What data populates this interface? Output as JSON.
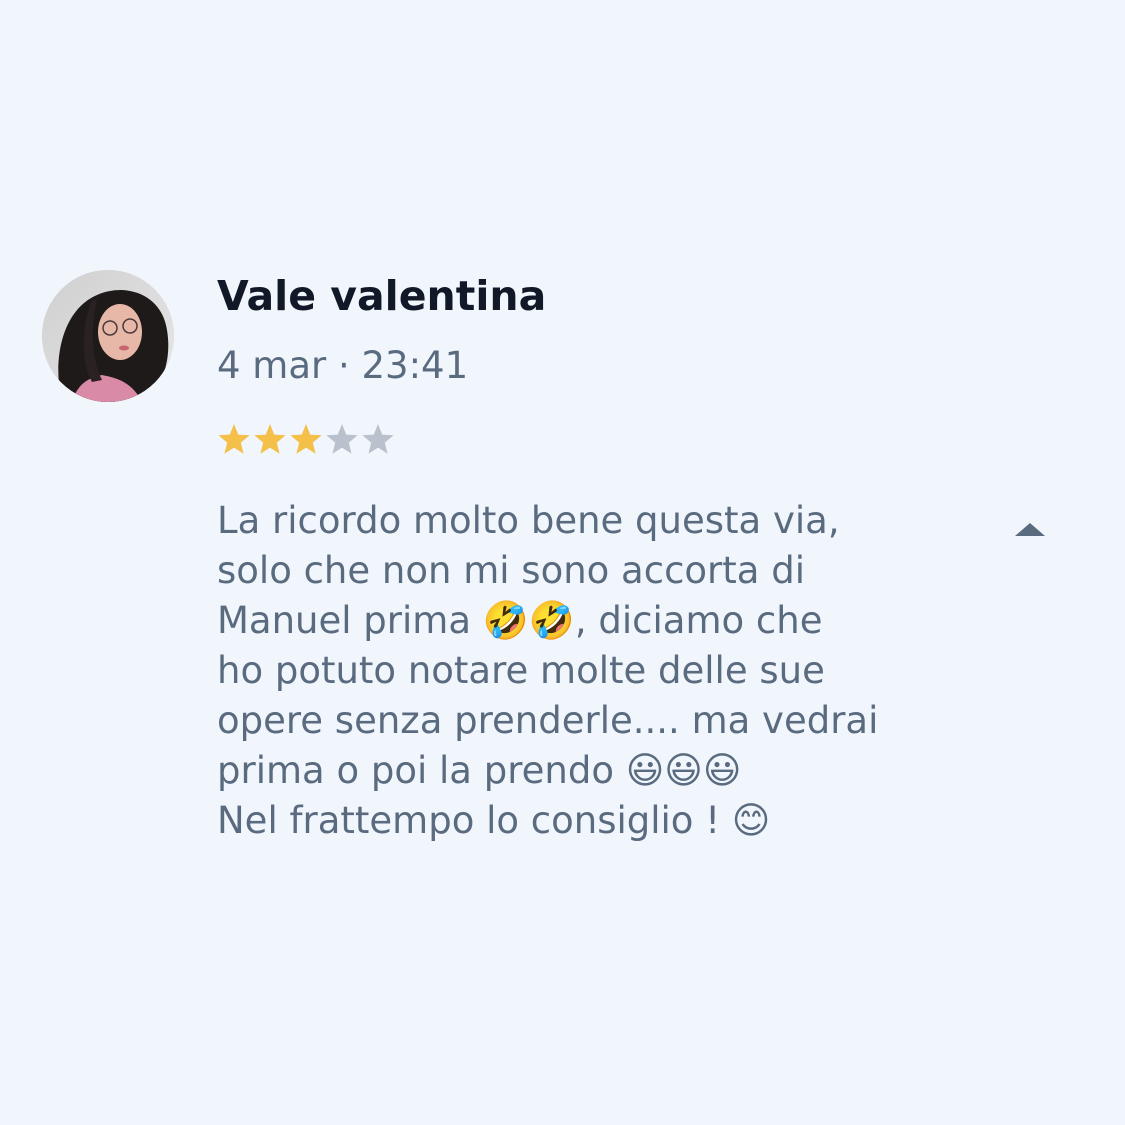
{
  "review": {
    "author": "Vale valentina",
    "date": "4 mar · 23:41",
    "rating": 3,
    "max_rating": 5,
    "text": "La ricordo molto bene questa via,\nsolo che non mi sono accorta di\nManuel prima 🤣🤣, diciamo che\nho potuto notare molte delle sue\nopere senza prenderle.... ma vedrai\nprima o poi la prendo 😃😃😃\nNel frattempo lo consiglio ! 😊"
  },
  "icons": {
    "avatar": "user-photo",
    "star": "star-icon",
    "collapse": "caret-up-icon"
  },
  "colors": {
    "background": "#f1f6fc",
    "star_filled": "#f5c04a",
    "star_empty": "#b9c2cc",
    "text": "#5a6b80",
    "author": "#111827"
  }
}
